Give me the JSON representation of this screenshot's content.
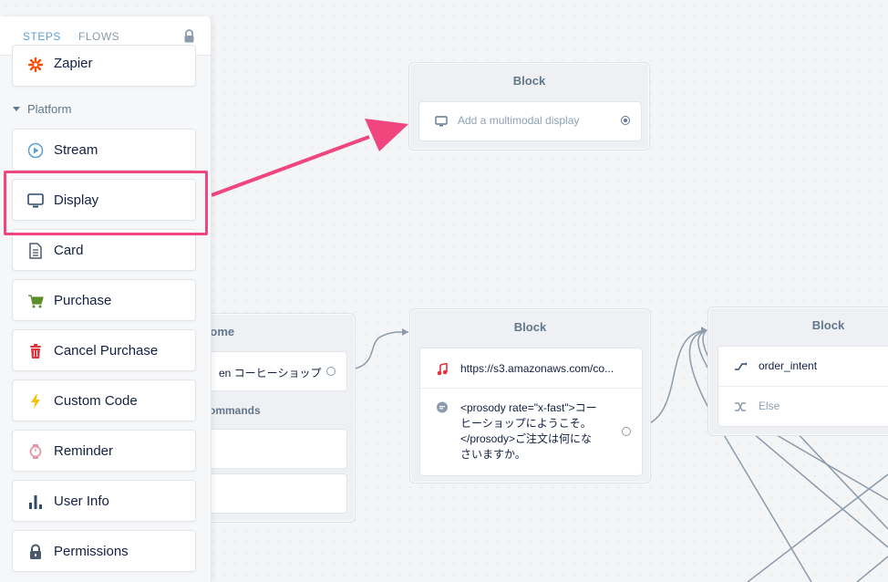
{
  "sidebar": {
    "tabs": [
      {
        "label": "STEPS",
        "active": true
      },
      {
        "label": "FLOWS",
        "active": false
      }
    ],
    "section_label": "Platform",
    "top_item": {
      "label": "Zapier",
      "icon": "zapier-icon"
    },
    "items": [
      {
        "label": "Stream",
        "icon": "play-circle-icon"
      },
      {
        "label": "Display",
        "icon": "monitor-icon"
      },
      {
        "label": "Card",
        "icon": "document-icon"
      },
      {
        "label": "Purchase",
        "icon": "cart-icon"
      },
      {
        "label": "Cancel Purchase",
        "icon": "trash-icon"
      },
      {
        "label": "Custom Code",
        "icon": "lightning-icon"
      },
      {
        "label": "Reminder",
        "icon": "watch-icon"
      },
      {
        "label": "User Info",
        "icon": "bar-chart-icon"
      },
      {
        "label": "Permissions",
        "icon": "lock-icon"
      }
    ]
  },
  "canvas": {
    "display_block": {
      "title": "Block",
      "step_text": "Add a multimodal display"
    },
    "home_block": {
      "title": "Home",
      "step_text": "en コーヒーショップ",
      "commands_label": "ommands"
    },
    "middle_block": {
      "title": "Block",
      "audio_text": "https://s3.amazonaws.com/co...",
      "speak_text": "<prosody rate=\"x-fast\">コーヒーショップにようこそ。</prosody>ご注文は何になさいますか。"
    },
    "right_block": {
      "title": "Block",
      "intent_text": "order_intent",
      "else_text": "Else"
    }
  },
  "colors": {
    "accent": "#5b9fd9",
    "highlight": "#f0467d",
    "zapier": "#ff4a00",
    "cart": "#5a8f29",
    "trash": "#e5333d",
    "lightning": "#f2c300",
    "reminder": "#e497a6",
    "userinfo": "#2f4a6a"
  }
}
